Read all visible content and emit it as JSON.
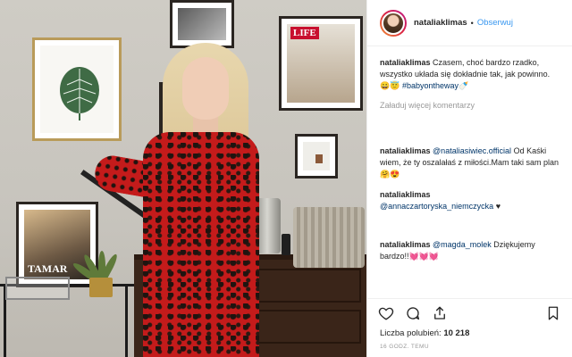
{
  "post": {
    "username": "nataliaklimas",
    "separator": "•",
    "follow_label": "Obserwuj",
    "caption": {
      "user": "nataliaklimas",
      "text": "Czasem, choć bardzo rzadko, wszystko układa się dokładnie tak, jak powinno.😀😇",
      "hashtag": "#babyontheway",
      "trail": "🍼"
    },
    "load_more": "Załaduj więcej komentarzy",
    "comments": [
      {
        "user": "nataliaklimas",
        "mention": "@nataliasiwiec.official",
        "text": " Od Kaśki wiem, że ty oszalałaś z miłości.Mam taki sam plan🤗😍"
      },
      {
        "user": "nataliaklimas",
        "mention": "@annaczartoryska_niemczycka",
        "text": " ♥"
      },
      {
        "user": "nataliaklimas",
        "mention": "@magda_molek",
        "text": " Dziękujemy bardzo!!💓💓💓"
      }
    ],
    "likes_label": "Liczba polubień:",
    "likes_count": "10 218",
    "timestamp": "16 GODZ. TEMU",
    "icons": [
      "heart-icon",
      "comment-icon",
      "share-icon",
      "bookmark-icon"
    ],
    "photo": {
      "life_text": "LIFE",
      "poster_text": "TAMAR"
    }
  }
}
